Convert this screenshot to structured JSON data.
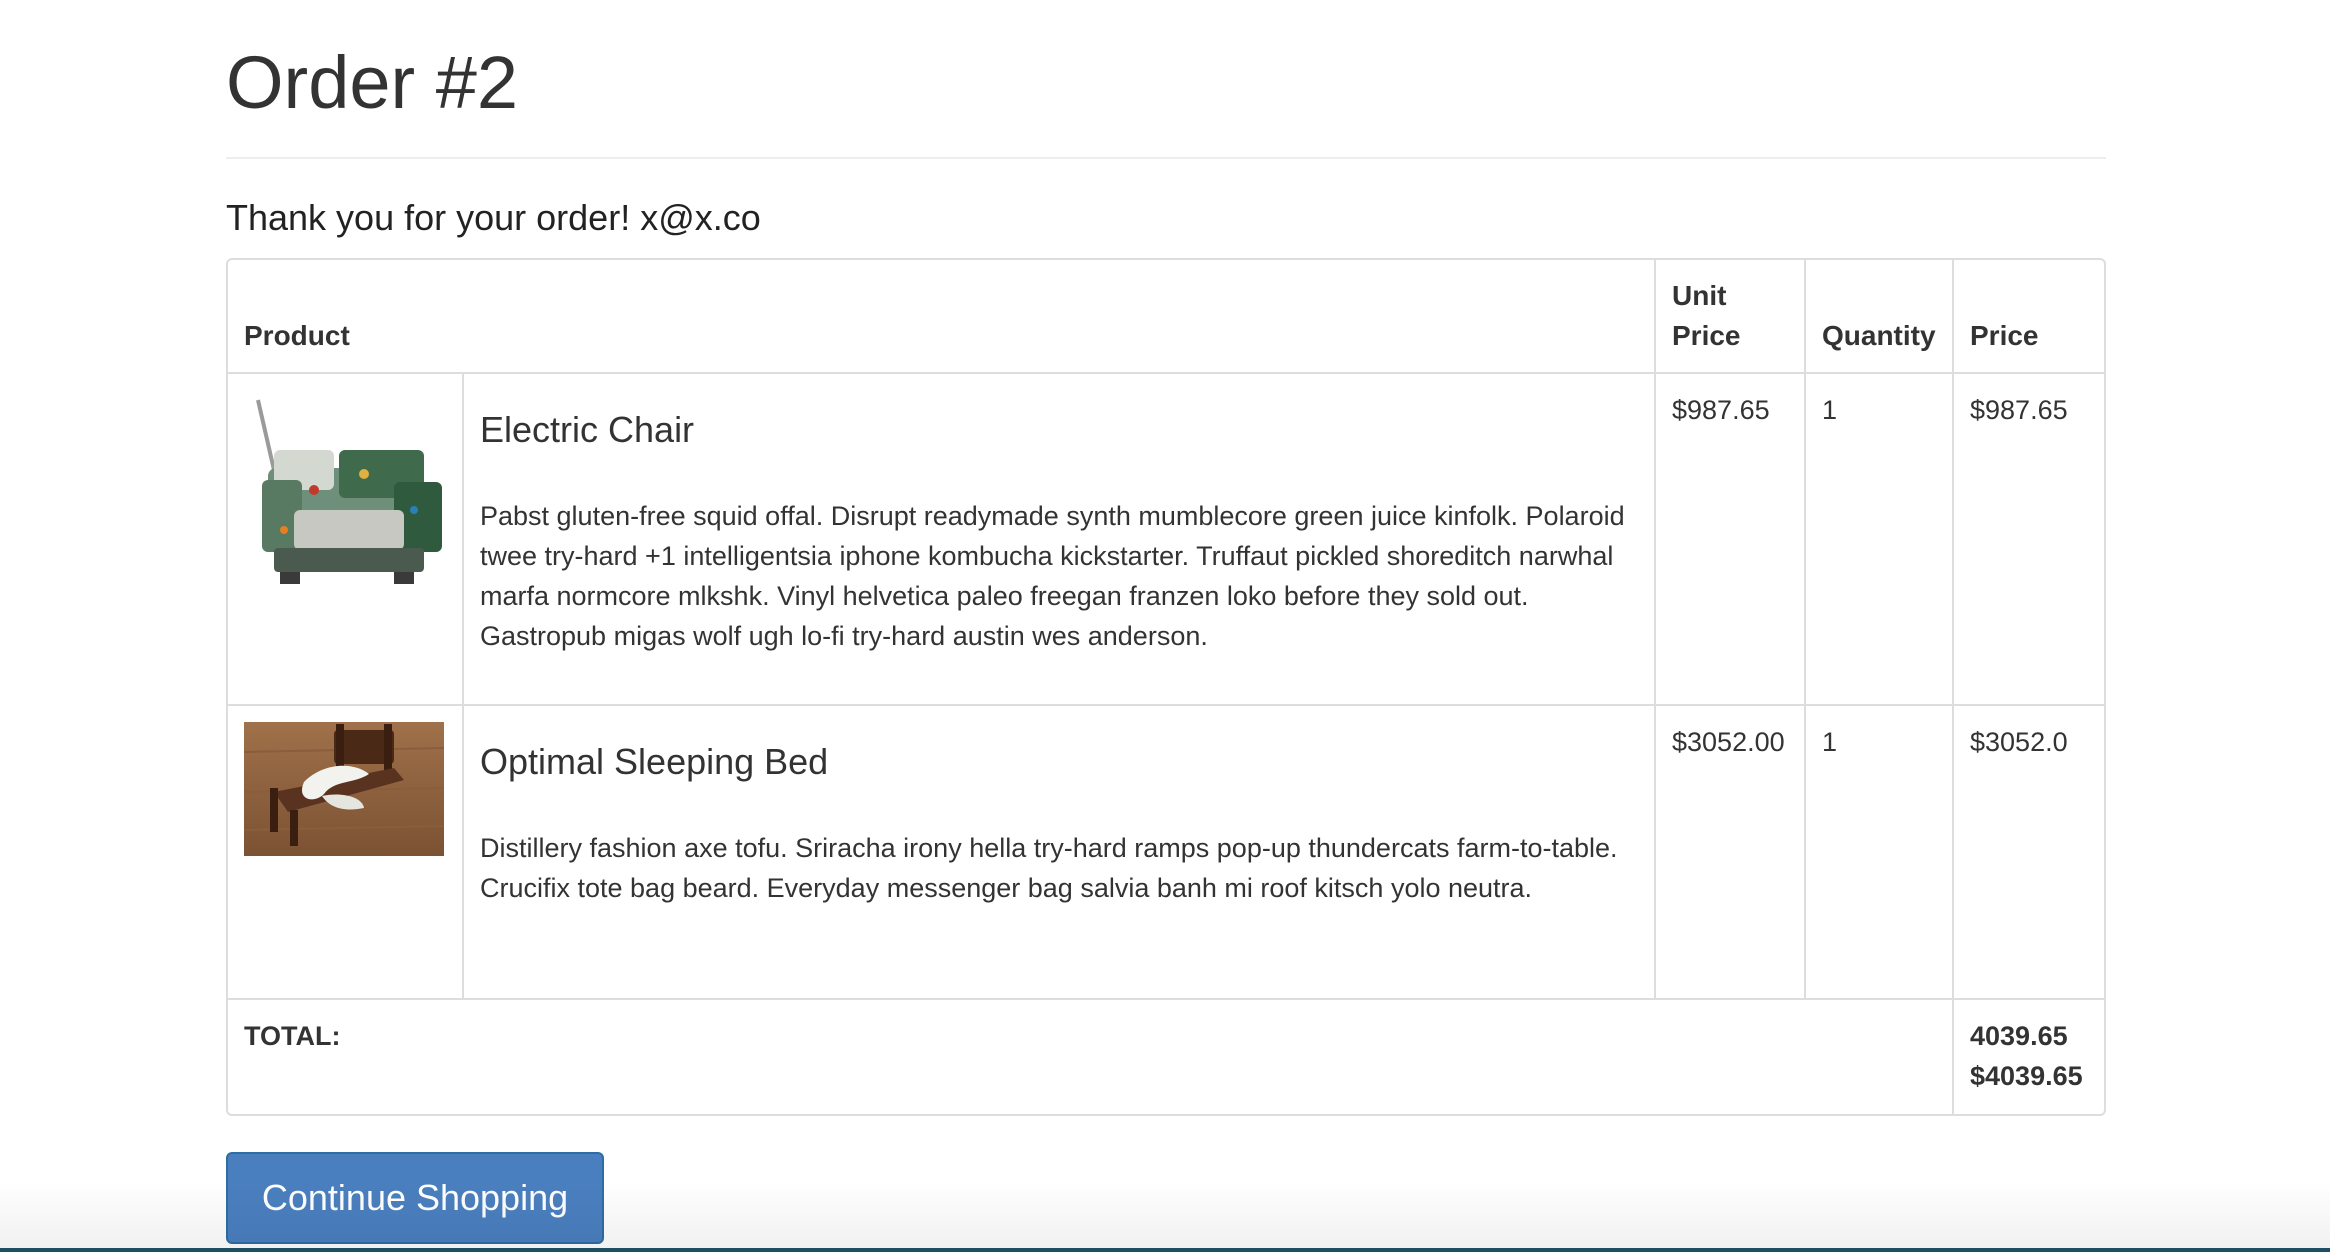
{
  "page": {
    "title": "Order #2",
    "thanks": "Thank you for your order! x@x.co"
  },
  "table": {
    "headers": {
      "product": "Product",
      "unit_price_line1": "Unit",
      "unit_price_line2": "Price",
      "quantity": "Quantity",
      "price": "Price"
    },
    "rows": [
      {
        "name": "Electric Chair",
        "description": "Pabst gluten-free squid offal. Disrupt readymade synth mumblecore green juice kinfolk. Polaroid twee try-hard +1 intelligentsia iphone kombucha kickstarter. Truffaut pickled shoreditch narwhal marfa normcore mlkshk. Vinyl helvetica paleo freegan franzen loko before they sold out. Gastropub migas wolf ugh lo-fi try-hard austin wes anderson.",
        "unit_price": "$987.65",
        "quantity": "1",
        "price": "$987.65"
      },
      {
        "name": "Optimal Sleeping Bed",
        "description": "Distillery fashion axe tofu. Sriracha irony hella try-hard ramps pop-up thundercats farm-to-table. Crucifix tote bag beard. Everyday messenger bag salvia banh mi roof kitsch yolo neutra.",
        "unit_price": "$3052.00",
        "quantity": "1",
        "price": "$3052.0"
      }
    ],
    "total": {
      "label": "TOTAL:",
      "value_line1": "4039.65",
      "value_line2": "$4039.65"
    }
  },
  "actions": {
    "continue_label": "Continue Shopping"
  },
  "colors": {
    "button": "#4a7fbf",
    "border": "#dddddd",
    "text": "#333333"
  }
}
